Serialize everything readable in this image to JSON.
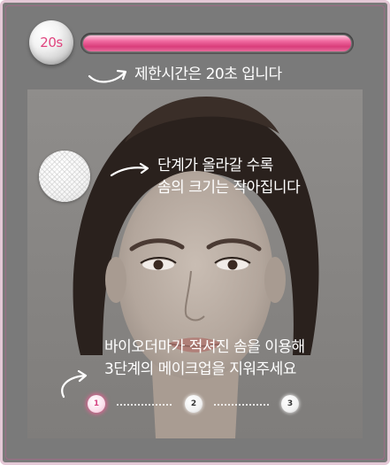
{
  "timer": {
    "seconds_label": "20s",
    "progress_fraction": 1.0,
    "caption": "제한시간은 20초 입니다"
  },
  "instructions": {
    "stage_line1": "단계가 올라갈 수록",
    "stage_line2": "솜의 크기는 작아집니다",
    "remove_line1": "바이오더마가 적셔진 솜을 이용해",
    "remove_line2": "3단계의 메이크업을 지워주세요"
  },
  "steps": {
    "labels": [
      "1",
      "2",
      "3"
    ],
    "active_index": 0
  },
  "colors": {
    "accent_pink": "#e0457f",
    "frame_gray": "#7a7a7a",
    "text_white": "#ffffff"
  },
  "icons": [
    "cotton-pad-icon",
    "curved-arrow-icon"
  ]
}
